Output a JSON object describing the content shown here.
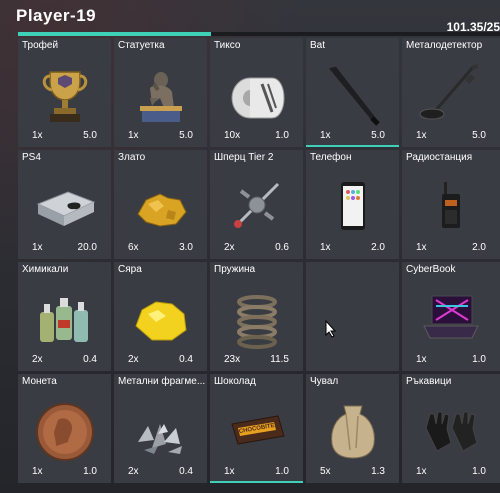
{
  "player": {
    "name": "Player-19",
    "weight": "101.35/25",
    "weight_fill": 0.4
  },
  "colors": {
    "accent": "#3fd1b7",
    "slot_bg": "#3a3c44",
    "background": "#2b2d33"
  },
  "items": [
    {
      "name": "Трофей",
      "qty": "1x",
      "weight": "5.0",
      "icon": "trophy-icon"
    },
    {
      "name": "Статуетка",
      "qty": "1x",
      "weight": "5.0",
      "icon": "thinker-statue-icon"
    },
    {
      "name": "Тиксо",
      "qty": "10x",
      "weight": "1.0",
      "icon": "tape-roll-icon"
    },
    {
      "name": "Bat",
      "qty": "1x",
      "weight": "5.0",
      "icon": "baseball-bat-icon"
    },
    {
      "name": "Металодетектор",
      "qty": "1x",
      "weight": "5.0",
      "icon": "metal-detector-icon"
    },
    {
      "name": "PS4",
      "qty": "1x",
      "weight": "20.0",
      "icon": "console-icon"
    },
    {
      "name": "Злато",
      "qty": "6x",
      "weight": "3.0",
      "icon": "gold-nugget-icon"
    },
    {
      "name": "Шперц Tier 2",
      "qty": "2x",
      "weight": "0.6",
      "icon": "lockpick-icon"
    },
    {
      "name": "Телефон",
      "qty": "1x",
      "weight": "2.0",
      "icon": "smartphone-icon"
    },
    {
      "name": "Радиостанция",
      "qty": "1x",
      "weight": "2.0",
      "icon": "radio-icon"
    },
    {
      "name": "Химикали",
      "qty": "2x",
      "weight": "0.4",
      "icon": "chemical-bottles-icon"
    },
    {
      "name": "Сяра",
      "qty": "2x",
      "weight": "0.4",
      "icon": "sulfur-icon"
    },
    {
      "name": "Пружина",
      "qty": "23x",
      "weight": "11.5",
      "icon": "spring-icon"
    },
    {
      "name": "",
      "qty": "",
      "weight": "",
      "icon": ""
    },
    {
      "name": "CyberBook",
      "qty": "1x",
      "weight": "1.0",
      "icon": "laptop-icon"
    },
    {
      "name": "Монета",
      "qty": "1x",
      "weight": "1.0",
      "icon": "coin-icon"
    },
    {
      "name": "Метални фрагме...",
      "qty": "2x",
      "weight": "0.4",
      "icon": "metal-fragments-icon"
    },
    {
      "name": "Шоколад",
      "qty": "1x",
      "weight": "1.0",
      "icon": "chocolate-bar-icon"
    },
    {
      "name": "Чувал",
      "qty": "5x",
      "weight": "1.3",
      "icon": "sack-icon"
    },
    {
      "name": "Ръкавици",
      "qty": "1x",
      "weight": "1.0",
      "icon": "gloves-icon"
    }
  ],
  "chocolate_label": "CHOCOBITE"
}
